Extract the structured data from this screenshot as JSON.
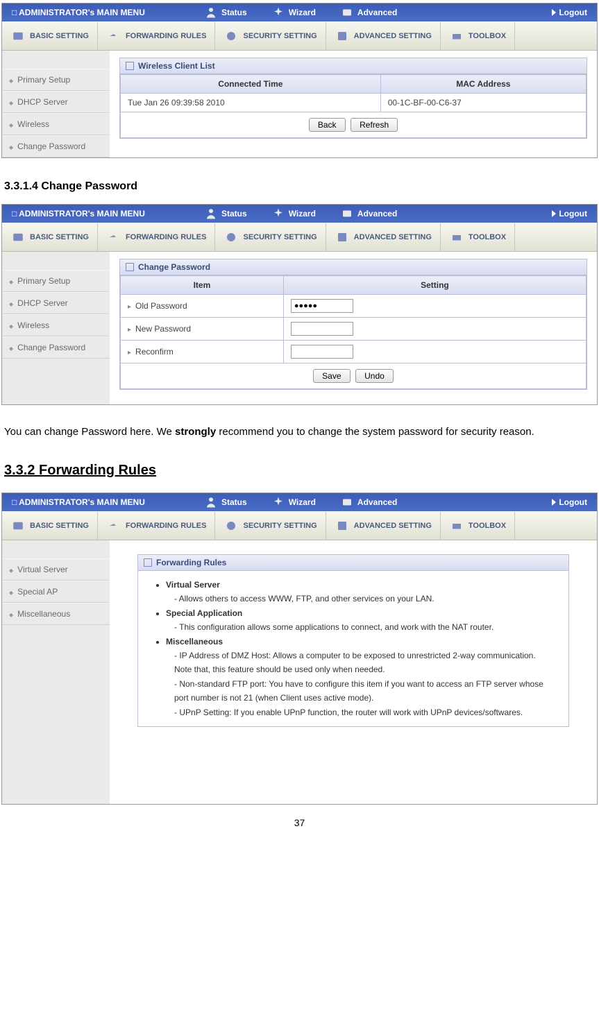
{
  "top": {
    "main": "ADMINISTRATOR's MAIN MENU",
    "status": "Status",
    "wizard": "Wizard",
    "advanced": "Advanced",
    "logout": "Logout"
  },
  "tabs": {
    "basic": "BASIC SETTING",
    "forward": "FORWARDING RULES",
    "security": "SECURITY SETTING",
    "advset": "ADVANCED SETTING",
    "toolbox": "TOOLBOX"
  },
  "side1": {
    "a": "Primary Setup",
    "b": "DHCP Server",
    "c": "Wireless",
    "d": "Change Password"
  },
  "side3": {
    "a": "Virtual Server",
    "b": "Special AP",
    "c": "Miscellaneous"
  },
  "s1": {
    "panel": "Wireless Client List",
    "hTime": "Connected Time",
    "hMac": "MAC Address",
    "row_time": "Tue Jan 26 09:39:58 2010",
    "row_mac": "00-1C-BF-00-C6-37",
    "back": "Back",
    "refresh": "Refresh"
  },
  "h1": "3.3.1.4 Change Password",
  "s2": {
    "panel": "Change Password",
    "hItem": "Item",
    "hSet": "Setting",
    "old": "Old Password",
    "new": "New Password",
    "re": "Reconfirm",
    "oldval": "●●●●●",
    "save": "Save",
    "undo": "Undo"
  },
  "p1a": "You can change Password here. We ",
  "p1b": "strongly",
  "p1c": " recommend you to change the system password for security reason.",
  "h2": "3.3.2 Forwarding Rules",
  "s3": {
    "panel": "Forwarding Rules",
    "vs": "Virtual Server",
    "vs1": "Allows others to access WWW, FTP, and other services on your LAN.",
    "sa": "Special Application",
    "sa1": "This configuration allows some applications to connect, and work with the NAT router.",
    "mi": "Miscellaneous",
    "mi1": "IP Address of DMZ Host: Allows a computer to be exposed to unrestricted 2-way communication. Note that, this feature should be used only when needed.",
    "mi2": "Non-standard FTP port: You have to configure this item if you want to access an FTP server whose port number is not 21 (when Client uses active mode).",
    "mi3": "UPnP Setting: If you enable UPnP function, the router will work with UPnP devices/softwares."
  },
  "pagenum": "37"
}
